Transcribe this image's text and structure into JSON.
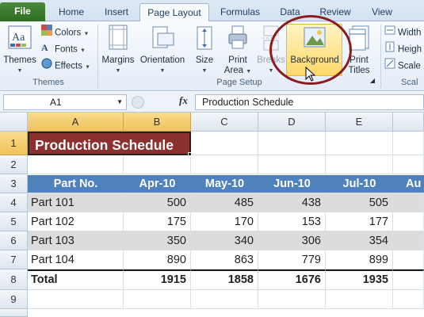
{
  "tabs": [
    "File",
    "Home",
    "Insert",
    "Page Layout",
    "Formulas",
    "Data",
    "Review",
    "View"
  ],
  "ribbon": {
    "themes": {
      "themes_label": "Themes",
      "colors": "Colors",
      "fonts": "Fonts",
      "effects": "Effects",
      "group": "Themes"
    },
    "page_setup": {
      "margins": "Margins",
      "orientation": "Orientation",
      "size": "Size",
      "print_area_1": "Print",
      "print_area_2": "Area",
      "breaks": "Breaks",
      "background": "Background",
      "print_titles_1": "Print",
      "print_titles_2": "Titles",
      "group": "Page Setup"
    },
    "scale": {
      "width": "Width",
      "height": "Heigh",
      "scale": "Scale",
      "group": "Scal"
    }
  },
  "formula_bar": {
    "name_box": "A1",
    "fx": "fx",
    "content": "Production Schedule"
  },
  "grid": {
    "columns": [
      "A",
      "B",
      "C",
      "D",
      "E"
    ],
    "rows": [
      "1",
      "2",
      "3",
      "4",
      "5",
      "6",
      "7",
      "8",
      "9"
    ],
    "title": "Production Schedule",
    "header": [
      "Part No.",
      "Apr-10",
      "May-10",
      "Jun-10",
      "Jul-10",
      "Au"
    ],
    "data": [
      {
        "part": "Part 101",
        "v": [
          "500",
          "485",
          "438",
          "505"
        ]
      },
      {
        "part": "Part 102",
        "v": [
          "175",
          "170",
          "153",
          "177"
        ]
      },
      {
        "part": "Part 103",
        "v": [
          "350",
          "340",
          "306",
          "354"
        ]
      },
      {
        "part": "Part 104",
        "v": [
          "890",
          "863",
          "779",
          "899"
        ]
      }
    ],
    "total": {
      "label": "Total",
      "v": [
        "1915",
        "1858",
        "1676",
        "1935"
      ]
    }
  },
  "colors": {
    "file_tab": "#2f6d24",
    "header_fill": "#4f81bd",
    "title_fill": "#8b2f2f",
    "highlight_circle": "#8a1d1d"
  }
}
